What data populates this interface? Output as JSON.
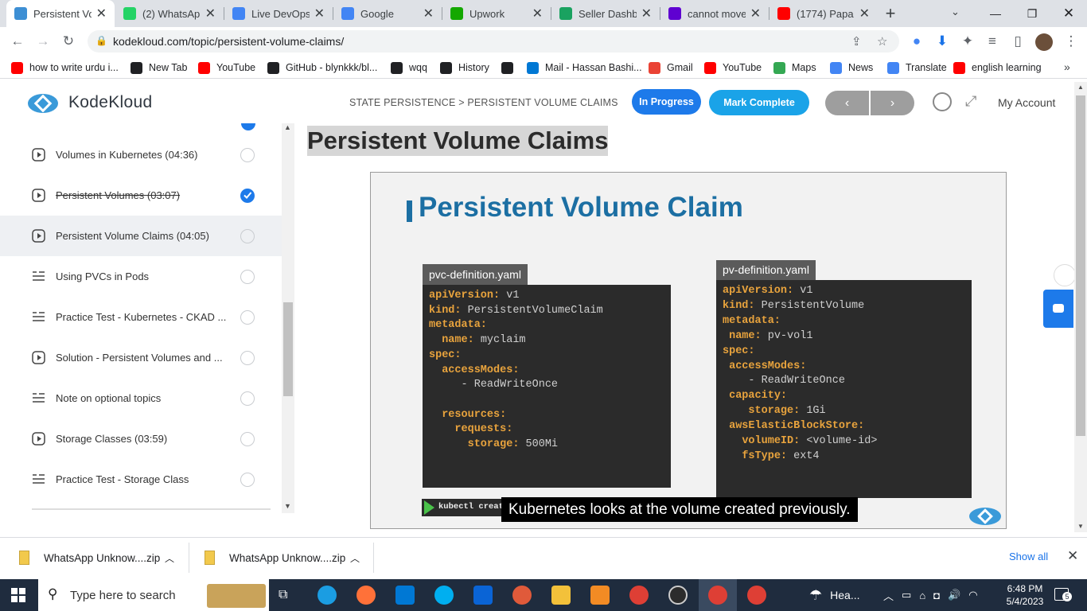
{
  "browser": {
    "tabs": [
      {
        "title": "Persistent Vol",
        "favicon_color": "#3d8fd4",
        "active": true
      },
      {
        "title": "(2) WhatsApp",
        "favicon_color": "#25d366",
        "active": false
      },
      {
        "title": "Live DevOps I",
        "favicon_color": "#4285f4",
        "active": false
      },
      {
        "title": "Google",
        "favicon_color": "#4285f4",
        "active": false
      },
      {
        "title": "Upwork",
        "favicon_color": "#14a800",
        "active": false
      },
      {
        "title": "Seller Dashbo",
        "favicon_color": "#1aa260",
        "active": false
      },
      {
        "title": "cannot move",
        "favicon_color": "#5f01d1",
        "active": false
      },
      {
        "title": "(1774) Papa J",
        "favicon_color": "#ff0000",
        "active": false
      }
    ],
    "url": "kodekloud.com/topic/persistent-volume-claims/",
    "bookmarks": [
      {
        "label": "how to write urdu i...",
        "icon_color": "#ff0000"
      },
      {
        "label": "New Tab",
        "icon_color": "#202124"
      },
      {
        "label": "YouTube",
        "icon_color": "#ff0000"
      },
      {
        "label": "GitHub - blynkkk/bl...",
        "icon_color": "#202124"
      },
      {
        "label": "wqq",
        "icon_color": "#202124"
      },
      {
        "label": "History",
        "icon_color": "#202124"
      },
      {
        "label": "",
        "icon_color": "#202124"
      },
      {
        "label": "Mail - Hassan Bashi...",
        "icon_color": "#0078d4"
      },
      {
        "label": "Gmail",
        "icon_color": "#ea4335"
      },
      {
        "label": "YouTube",
        "icon_color": "#ff0000"
      },
      {
        "label": "Maps",
        "icon_color": "#34a853"
      },
      {
        "label": "News",
        "icon_color": "#4285f4"
      },
      {
        "label": "Translate",
        "icon_color": "#4285f4"
      },
      {
        "label": "english learning",
        "icon_color": "#ff0000"
      }
    ]
  },
  "header": {
    "logo": "KodeKloud",
    "breadcrumb": "STATE PERSISTENCE > PERSISTENT VOLUME CLAIMS",
    "status_label": "In Progress",
    "mark_complete_label": "Mark Complete",
    "account_label": "My Account",
    "prev_glyph": "‹",
    "next_glyph": "›"
  },
  "sidebar": {
    "lessons": [
      {
        "label": "Volumes in Kubernetes (04:36)",
        "type": "video",
        "done": false,
        "current": false,
        "strike": false
      },
      {
        "label": "Persistent Volumes (03:07)",
        "type": "video",
        "done": true,
        "current": false,
        "strike": true
      },
      {
        "label": "Persistent Volume Claims (04:05)",
        "type": "video",
        "done": false,
        "current": true,
        "strike": false
      },
      {
        "label": "Using PVCs in Pods",
        "type": "text",
        "done": false,
        "current": false,
        "strike": false
      },
      {
        "label": "Practice Test - Kubernetes - CKAD ...",
        "type": "text",
        "done": false,
        "current": false,
        "strike": false
      },
      {
        "label": "Solution - Persistent Volumes and ...",
        "type": "video",
        "done": false,
        "current": false,
        "strike": false
      },
      {
        "label": "Note on optional topics",
        "type": "text",
        "done": false,
        "current": false,
        "strike": false
      },
      {
        "label": "Storage Classes (03:59)",
        "type": "video",
        "done": false,
        "current": false,
        "strike": false
      },
      {
        "label": "Practice Test - Storage Class",
        "type": "text",
        "done": false,
        "current": false,
        "strike": false
      }
    ]
  },
  "content": {
    "title": "Persistent Volume Claims",
    "slide": {
      "heading": "Persistent Volume Claim",
      "pvc_file": "pvc-definition.yaml",
      "pv_file": "pv-definition.yaml",
      "pvc_lines": [
        {
          "indent": "",
          "key": "apiVersion:",
          "val": " v1"
        },
        {
          "indent": "",
          "key": "kind:",
          "val": " PersistentVolumeClaim"
        },
        {
          "indent": "",
          "key": "metadata:",
          "val": ""
        },
        {
          "indent": "  ",
          "key": "name:",
          "val": " myclaim"
        },
        {
          "indent": "",
          "key": "spec:",
          "val": ""
        },
        {
          "indent": "  ",
          "key": "accessModes:",
          "val": ""
        },
        {
          "indent": "     ",
          "key": "",
          "val": "- ReadWriteOnce"
        },
        {
          "indent": "",
          "key": "",
          "val": ""
        },
        {
          "indent": "  ",
          "key": "resources:",
          "val": ""
        },
        {
          "indent": "    ",
          "key": "requests:",
          "val": ""
        },
        {
          "indent": "      ",
          "key": "storage:",
          "val": " 500Mi"
        }
      ],
      "pv_lines": [
        {
          "indent": "",
          "key": "apiVersion:",
          "val": " v1"
        },
        {
          "indent": "",
          "key": "kind:",
          "val": " PersistentVolume"
        },
        {
          "indent": "",
          "key": "metadata:",
          "val": ""
        },
        {
          "indent": " ",
          "key": "name:",
          "val": " pv-vol1"
        },
        {
          "indent": "",
          "key": "spec:",
          "val": ""
        },
        {
          "indent": " ",
          "key": "accessModes:",
          "val": ""
        },
        {
          "indent": "    ",
          "key": "",
          "val": "- ReadWriteOnce"
        },
        {
          "indent": " ",
          "key": "capacity:",
          "val": ""
        },
        {
          "indent": "    ",
          "key": "storage:",
          "val": " 1Gi"
        },
        {
          "indent": " ",
          "key": "awsElasticBlockStore:",
          "val": ""
        },
        {
          "indent": "   ",
          "key": "volumeID:",
          "val": " <volume-id>"
        },
        {
          "indent": "   ",
          "key": "fsType:",
          "val": " ext4"
        }
      ],
      "terminal_text": "kubectl creat"
    },
    "caption": "Kubernetes looks at the volume created previously."
  },
  "downloads": {
    "items": [
      {
        "name": "WhatsApp Unknow....zip"
      },
      {
        "name": "WhatsApp Unknow....zip"
      }
    ],
    "show_all_label": "Show all"
  },
  "taskbar": {
    "search_placeholder": "Type here to search",
    "weather_label": "Hea...",
    "time": "6:48 PM",
    "date": "5/4/2023",
    "notification_count": "5"
  }
}
